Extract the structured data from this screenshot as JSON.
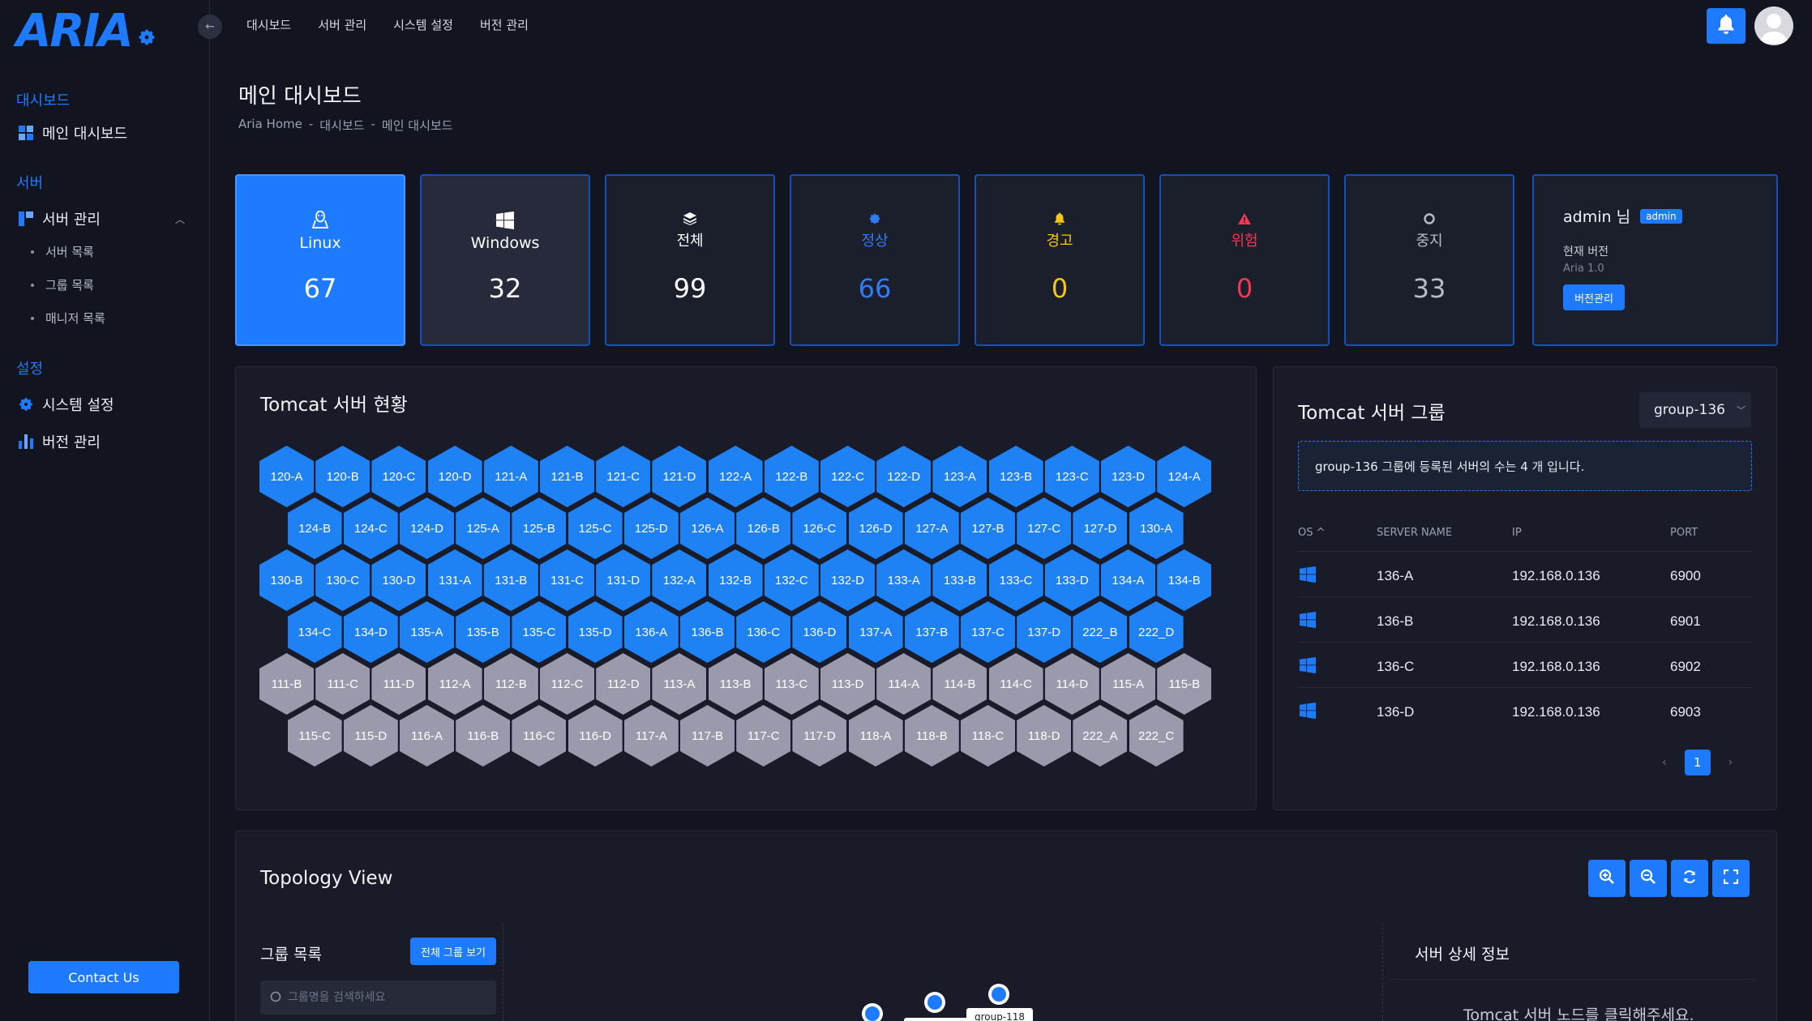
{
  "brand": {
    "name": "ARIA"
  },
  "topnav": [
    "대시보드",
    "서버 관리",
    "시스템 설정",
    "버전 관리"
  ],
  "sidebar": {
    "section_dashboard": "대시보드",
    "main_dashboard": "메인 대시보드",
    "section_server": "서버",
    "server_mgmt": "서버 관리",
    "subs": [
      "서버 목록",
      "그룹 목록",
      "매니저 목록"
    ],
    "section_settings": "설정",
    "system_settings": "시스템 설정",
    "version_mgmt": "버전 관리",
    "contact": "Contact Us"
  },
  "page": {
    "title": "메인 대시보드",
    "breadcrumb": [
      "Aria Home",
      "-",
      "대시보드",
      "-",
      "메인 대시보드"
    ]
  },
  "stats": [
    {
      "label": "Linux",
      "value": "67",
      "icon": "linux-icon"
    },
    {
      "label": "Windows",
      "value": "32",
      "icon": "windows-icon"
    },
    {
      "label": "전체",
      "value": "99",
      "icon": "layers-icon",
      "color": "#ffffff"
    },
    {
      "label": "정상",
      "value": "66",
      "icon": "gear-icon",
      "color": "#2f7df6"
    },
    {
      "label": "경고",
      "value": "0",
      "icon": "bell-icon",
      "color": "#f5c518"
    },
    {
      "label": "위험",
      "value": "0",
      "icon": "warning-icon",
      "color": "#f03a52"
    },
    {
      "label": "중지",
      "value": "33",
      "icon": "stop-icon",
      "color": "#b7bccb"
    }
  ],
  "admin": {
    "name": "admin 님",
    "badge": "admin",
    "version_label": "현재 버전",
    "version_value": "Aria 1.0",
    "version_button": "버전관리"
  },
  "tomcat_status": {
    "title": "Tomcat 서버 현황",
    "rows": [
      {
        "state": "on",
        "items": [
          "120-A",
          "120-B",
          "120-C",
          "120-D",
          "121-A",
          "121-B",
          "121-C",
          "121-D",
          "122-A",
          "122-B",
          "122-C",
          "122-D",
          "123-A",
          "123-B",
          "123-C",
          "123-D",
          "124-A"
        ]
      },
      {
        "state": "on",
        "items": [
          "124-B",
          "124-C",
          "124-D",
          "125-A",
          "125-B",
          "125-C",
          "125-D",
          "126-A",
          "126-B",
          "126-C",
          "126-D",
          "127-A",
          "127-B",
          "127-C",
          "127-D",
          "130-A"
        ]
      },
      {
        "state": "on",
        "items": [
          "130-B",
          "130-C",
          "130-D",
          "131-A",
          "131-B",
          "131-C",
          "131-D",
          "132-A",
          "132-B",
          "132-C",
          "132-D",
          "133-A",
          "133-B",
          "133-C",
          "133-D",
          "134-A",
          "134-B"
        ]
      },
      {
        "state": "on",
        "items": [
          "134-C",
          "134-D",
          "135-A",
          "135-B",
          "135-C",
          "135-D",
          "136-A",
          "136-B",
          "136-C",
          "136-D",
          "137-A",
          "137-B",
          "137-C",
          "137-D",
          "222_B",
          "222_D"
        ]
      },
      {
        "state": "off",
        "items": [
          "111-B",
          "111-C",
          "111-D",
          "112-A",
          "112-B",
          "112-C",
          "112-D",
          "113-A",
          "113-B",
          "113-C",
          "113-D",
          "114-A",
          "114-B",
          "114-C",
          "114-D",
          "115-A",
          "115-B"
        ]
      },
      {
        "state": "off",
        "items": [
          "115-C",
          "115-D",
          "116-A",
          "116-B",
          "116-C",
          "116-D",
          "117-A",
          "117-B",
          "117-C",
          "117-D",
          "118-A",
          "118-B",
          "118-C",
          "118-D",
          "222_A",
          "222_C"
        ]
      }
    ]
  },
  "tomcat_group": {
    "title": "Tomcat 서버 그룹",
    "selected": "group-136",
    "notice": "group-136 그룹에 등록된 서버의 수는 4 개 입니다.",
    "columns": [
      "OS ^",
      "SERVER NAME",
      "IP",
      "PORT"
    ],
    "rows": [
      {
        "os": "windows-icon",
        "name": "136-A",
        "ip": "192.168.0.136",
        "port": "6900"
      },
      {
        "os": "windows-icon",
        "name": "136-B",
        "ip": "192.168.0.136",
        "port": "6901"
      },
      {
        "os": "windows-icon",
        "name": "136-C",
        "ip": "192.168.0.136",
        "port": "6902"
      },
      {
        "os": "windows-icon",
        "name": "136-D",
        "ip": "192.168.0.136",
        "port": "6903"
      }
    ],
    "page": "1",
    "prev": "‹",
    "next": "›"
  },
  "topology": {
    "title": "Topology View",
    "group_list_title": "그룹 목록",
    "all_groups_button": "전체 그룹 보기",
    "search_placeholder": "그룹명을 검색하세요",
    "node_label": "group-118",
    "detail_title": "서버 상세 정보",
    "detail_hint": "Tomcat 서버 노드를 클릭해주세요."
  },
  "colors": {
    "accent": "#1e7bff",
    "hex_on": "#1e82f5",
    "hex_off": "#9b9aac",
    "bg": "#121420"
  }
}
